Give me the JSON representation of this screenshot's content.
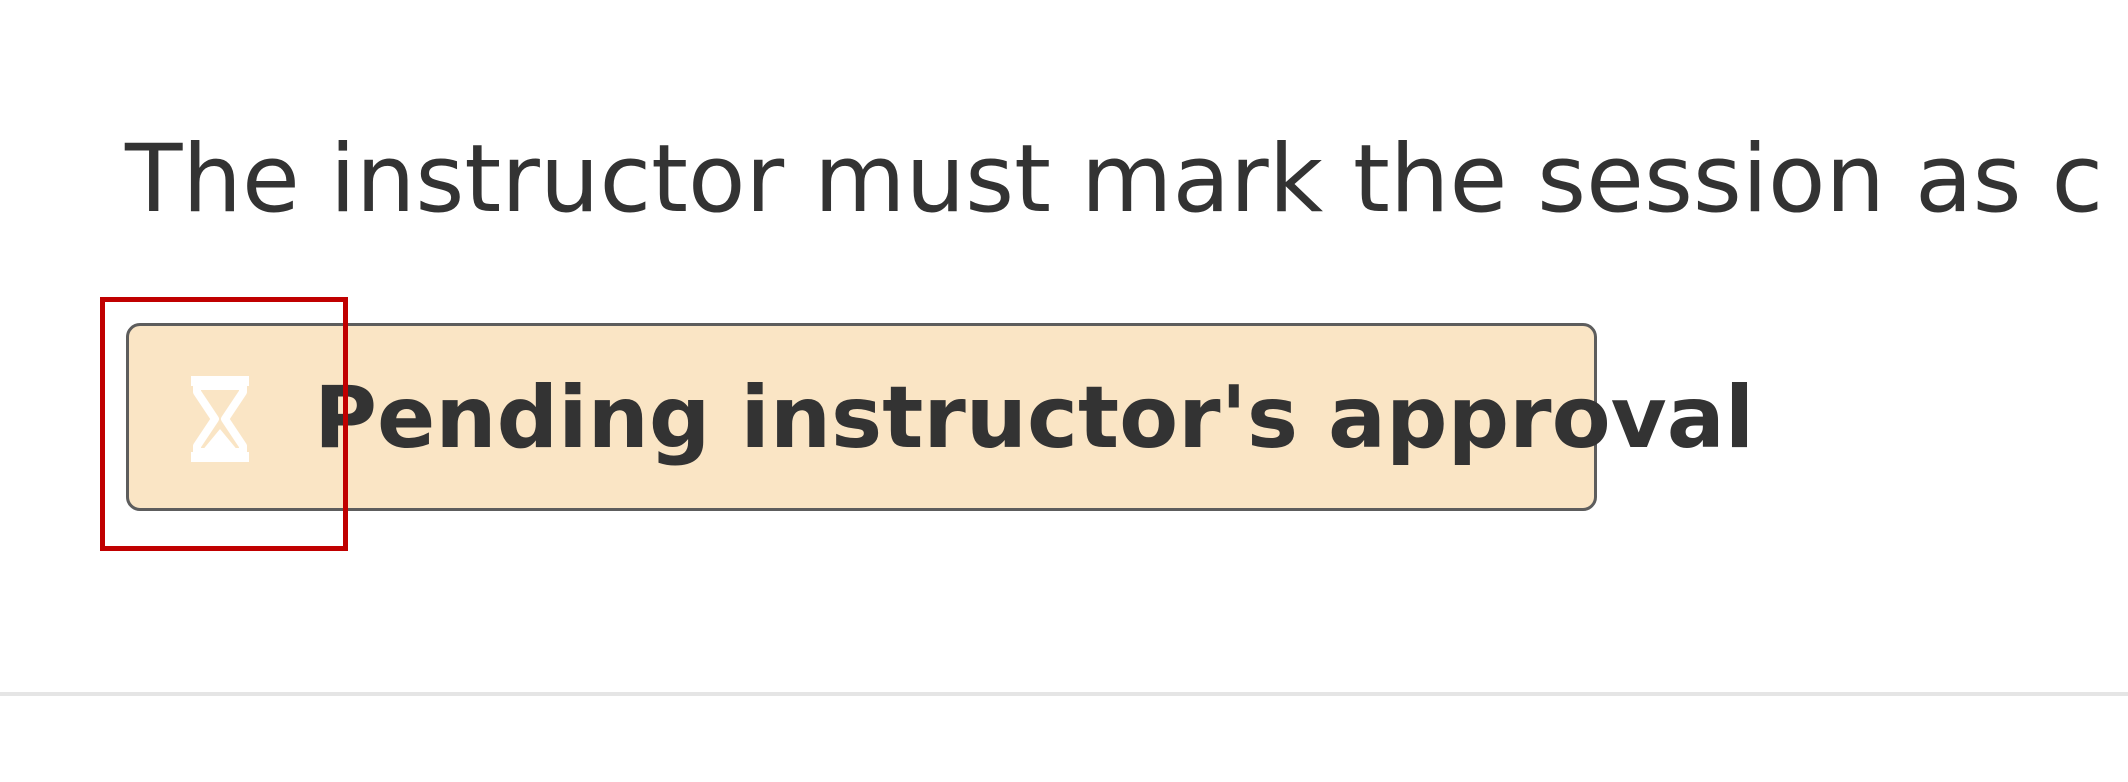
{
  "main": {
    "description": "The instructor must mark the session as c",
    "status": {
      "label": "Pending instructor's approval",
      "icon": "hourglass-icon",
      "background_color": "#fae5c5",
      "border_color": "#5d5d5d"
    },
    "highlight_color": "#c00000"
  }
}
